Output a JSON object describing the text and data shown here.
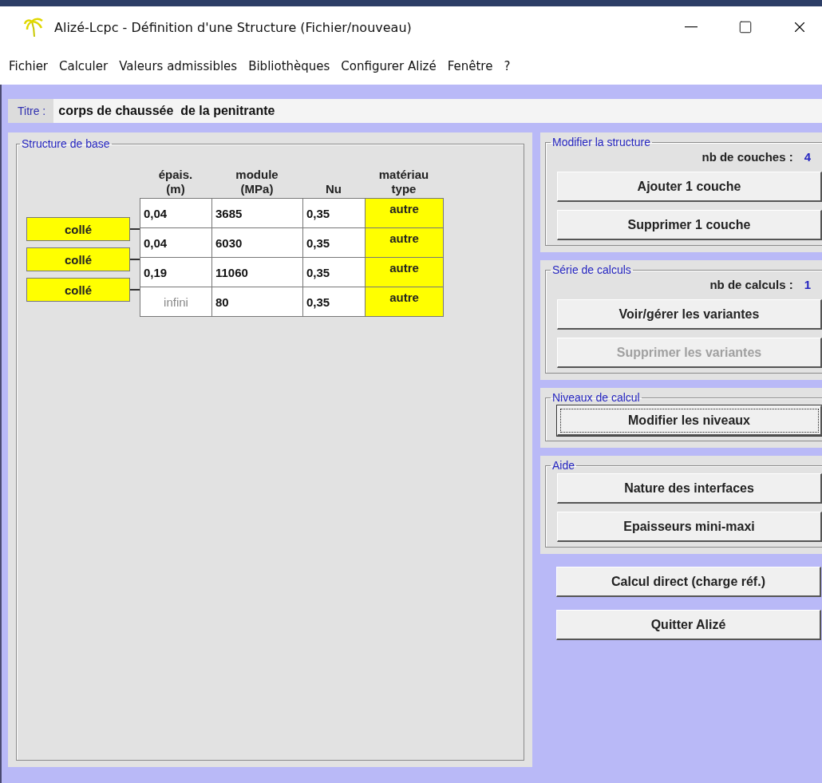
{
  "window": {
    "title": "Alizé-Lcpc - Définition d'une Structure (Fichier/nouveau)"
  },
  "menu": [
    "Fichier",
    "Calculer",
    "Valeurs admissibles",
    "Bibliothèques",
    "Configurer Alizé",
    "Fenêtre",
    "?"
  ],
  "titre": {
    "label": "Titre :",
    "value": "corps de chaussée  de la penitrante"
  },
  "structure": {
    "title": "Structure de base",
    "columns": [
      {
        "lines": [
          "épais.",
          "(m)"
        ]
      },
      {
        "lines": [
          "module",
          "(MPa)"
        ]
      },
      {
        "lines": [
          "Nu"
        ]
      },
      {
        "lines": [
          "matériau",
          "type"
        ]
      }
    ],
    "layers": [
      {
        "thickness": {
          "text": "0,04",
          "disabled": false
        },
        "module": "3685",
        "nu": "0,35",
        "material": "autre"
      },
      {
        "thickness": {
          "text": "0,04",
          "disabled": false
        },
        "module": "6030",
        "nu": "0,35",
        "material": "autre"
      },
      {
        "thickness": {
          "text": "0,19",
          "disabled": false
        },
        "module": "11060",
        "nu": "0,35",
        "material": "autre"
      },
      {
        "thickness": {
          "text": "infini",
          "disabled": true
        },
        "module": "80",
        "nu": "0,35",
        "material": "autre"
      }
    ],
    "interfaces": [
      "collé",
      "collé",
      "collé"
    ]
  },
  "groups": [
    {
      "title": "Modifier la structure",
      "count_label": "nb de couches :",
      "count_value": "4",
      "buttons": [
        {
          "label": "Ajouter 1 couche",
          "disabled": false,
          "focused": false
        },
        {
          "label": "Supprimer 1 couche",
          "disabled": false,
          "focused": false
        }
      ]
    },
    {
      "title": "Série de calculs",
      "count_label": "nb de calculs :",
      "count_value": "1",
      "buttons": [
        {
          "label": "Voir/gérer les variantes",
          "disabled": false,
          "focused": false
        },
        {
          "label": "Supprimer les variantes",
          "disabled": true,
          "focused": false
        }
      ]
    },
    {
      "title": "Niveaux de calcul",
      "buttons": [
        {
          "label": "Modifier les niveaux",
          "disabled": false,
          "focused": true
        }
      ]
    },
    {
      "title": "Aide",
      "buttons": [
        {
          "label": "Nature des interfaces",
          "disabled": false,
          "focused": false
        },
        {
          "label": "Epaisseurs mini-maxi",
          "disabled": false,
          "focused": false
        }
      ]
    }
  ],
  "actions": [
    {
      "label": "Calcul direct (charge réf.)",
      "disabled": false,
      "focused": false
    },
    {
      "label": "Quitter Alizé",
      "disabled": false,
      "focused": false
    }
  ]
}
